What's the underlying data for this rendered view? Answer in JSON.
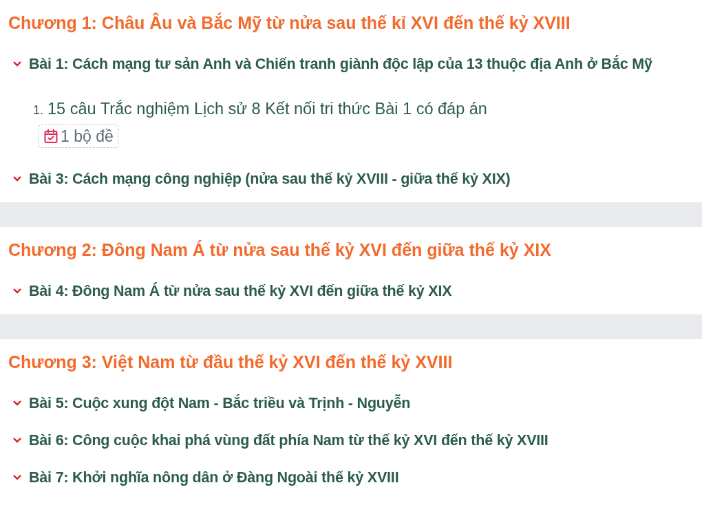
{
  "chapters": [
    {
      "title": "Chương 1: Châu Âu và Bắc Mỹ từ nửa sau thế kỉ XVI đến thế kỷ XVIII",
      "lessons": [
        {
          "title": "Bài 1: Cách mạng tư sản Anh và Chiến tranh giành độc lập của 13 thuộc địa Anh ở Bắc Mỹ",
          "items": [
            {
              "number": "1.",
              "title": "15 câu Trắc nghiệm Lịch sử 8 Kết nối tri thức Bài 1 có đáp án",
              "badge": "1 bộ đề"
            }
          ]
        },
        {
          "title": "Bài 3: Cách mạng công nghiệp (nửa sau thế kỷ XVIII - giữa thế kỷ XIX)"
        }
      ]
    },
    {
      "title": "Chương 2: Đông Nam Á từ nửa sau thế kỷ XVI đến giữa thế kỷ XIX",
      "lessons": [
        {
          "title": "Bài 4: Đông Nam Á từ nửa sau thế kỷ XVI đến giữa thế kỷ XIX"
        }
      ]
    },
    {
      "title": "Chương 3: Việt Nam từ đầu thế kỷ XVI đến thế kỷ XVIII",
      "lessons": [
        {
          "title": "Bài 5: Cuộc xung đột Nam - Bắc triều và Trịnh - Nguyễn"
        },
        {
          "title": "Bài 6: Công cuộc khai phá vùng đất phía Nam từ thế kỷ XVI đến thế kỷ XVIII"
        },
        {
          "title": "Bài 7: Khởi nghĩa nông dân ở Đàng Ngoài thế kỷ XVIII"
        }
      ]
    }
  ]
}
